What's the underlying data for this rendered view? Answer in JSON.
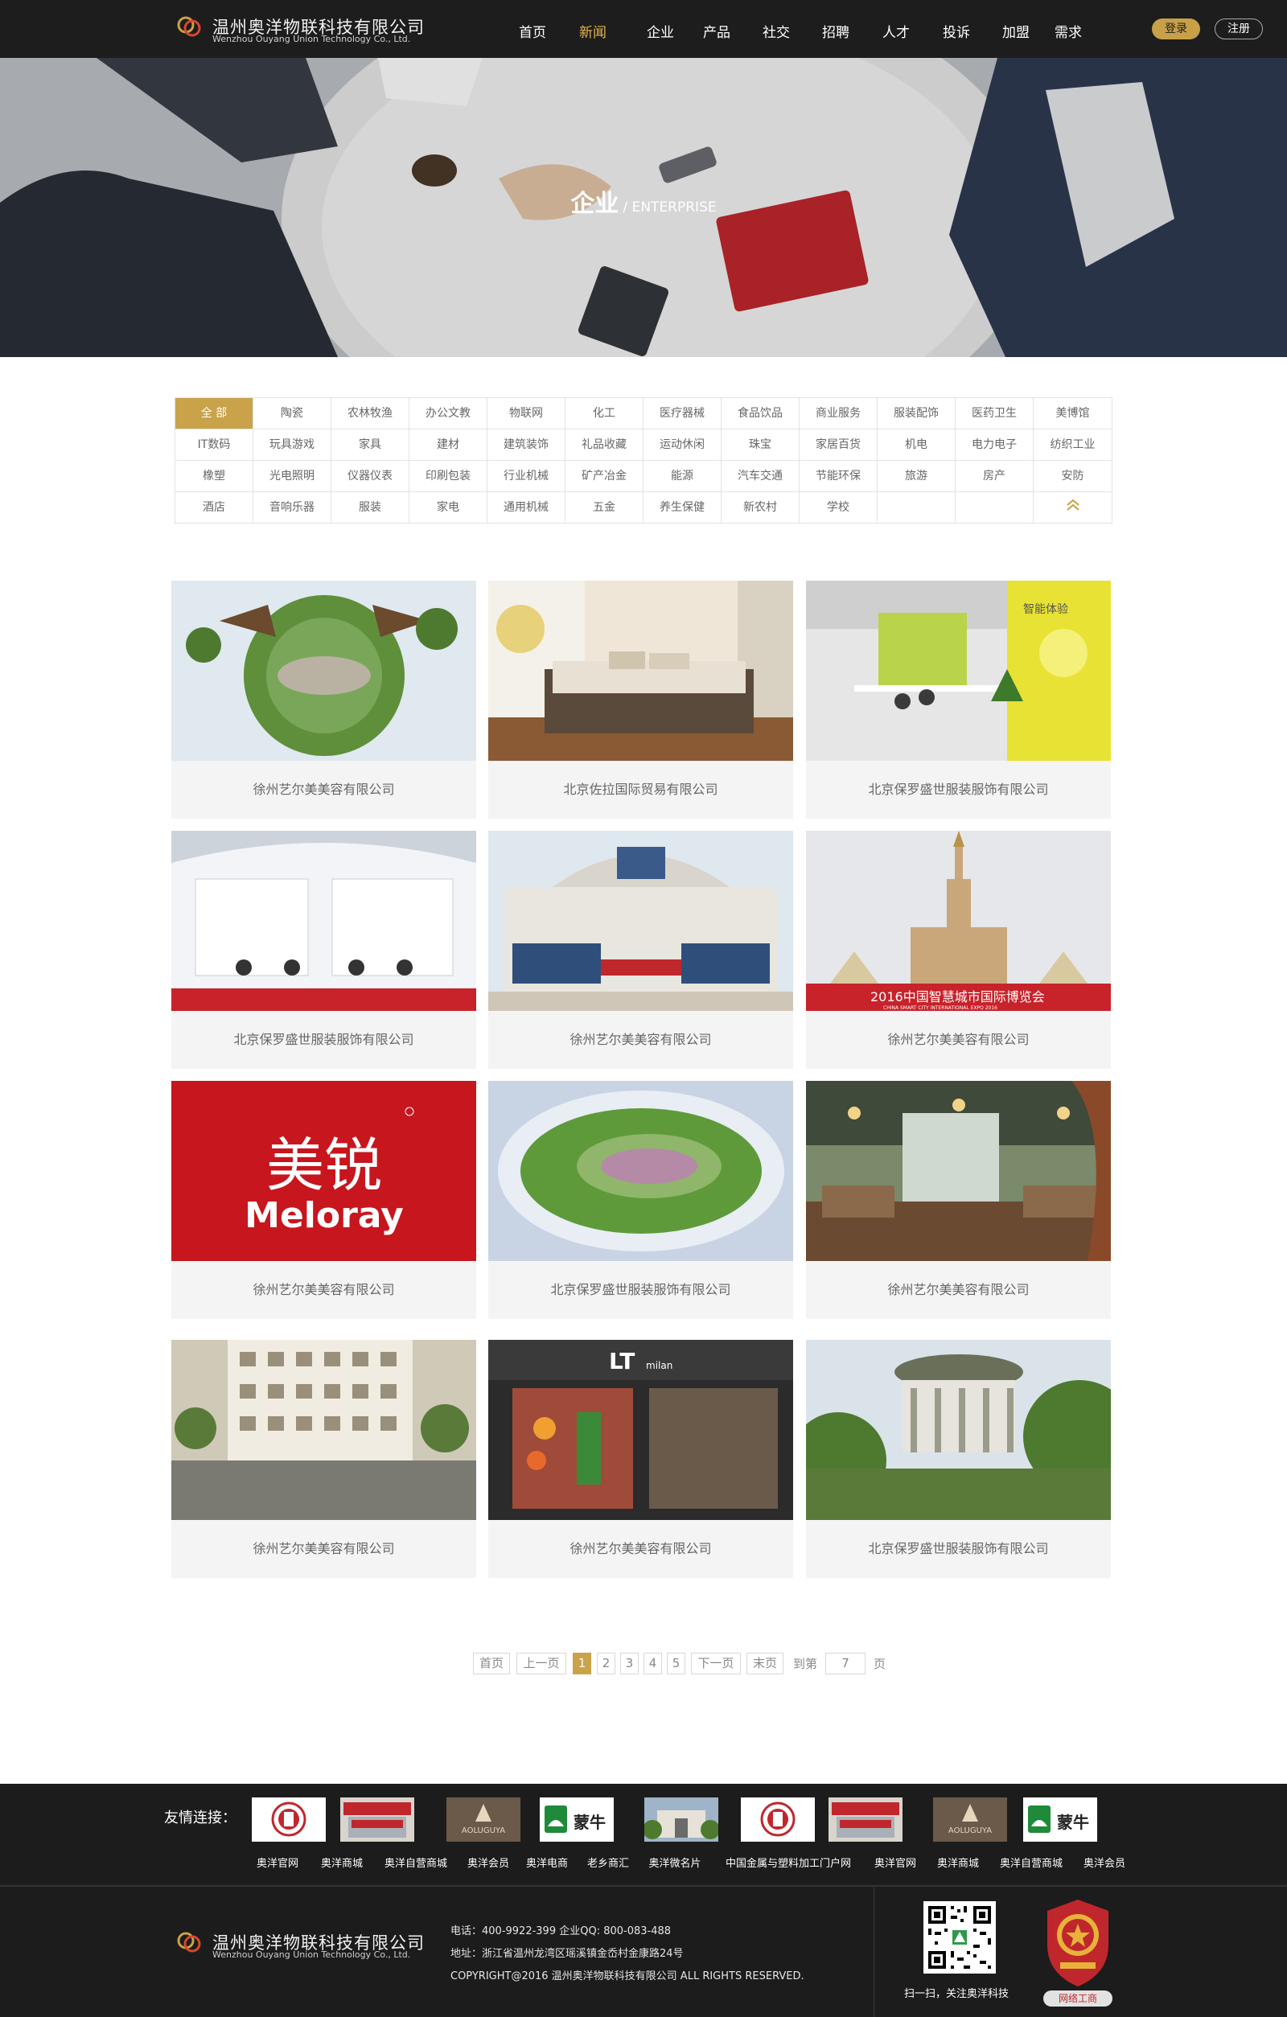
{
  "brand": {
    "name_cn": "温州奥洋物联科技有限公司",
    "name_en": "Wenzhou Ouyang Union Technology Co., Ltd.",
    "accent": "#c9a24a"
  },
  "nav": {
    "items": [
      "首页",
      "新闻",
      "企业",
      "产品",
      "社交",
      "招聘",
      "人才",
      "投诉",
      "加盟",
      "需求"
    ],
    "active": "新闻",
    "login": "登录",
    "register": "注册"
  },
  "banner": {
    "title_cn": "企业",
    "title_en": "/ ENTERPRISE"
  },
  "categories": [
    "全 部",
    "陶瓷",
    "农林牧渔",
    "办公文教",
    "物联网",
    "化工",
    "医疗器械",
    "食品饮品",
    "商业服务",
    "服装配饰",
    "医药卫生",
    "美博馆",
    "IT数码",
    "玩具游戏",
    "家具",
    "建材",
    "建筑装饰",
    "礼品收藏",
    "运动休闲",
    "珠宝",
    "家居百货",
    "机电",
    "电力电子",
    "纺织工业",
    "橡塑",
    "光电照明",
    "仪器仪表",
    "印刷包装",
    "行业机械",
    "矿产冶金",
    "能源",
    "汽车交通",
    "节能环保",
    "旅游",
    "房产",
    "安防",
    "酒店",
    "音响乐器",
    "服装",
    "家电",
    "通用机械",
    "五金",
    "养生保健",
    "新农村",
    "学校",
    "",
    "",
    ""
  ],
  "cards": [
    {
      "caption": "徐州艺尔美美容有限公司",
      "image": "planet-park"
    },
    {
      "caption": "北京佐拉国际贸易有限公司",
      "image": "bedroom"
    },
    {
      "caption": "北京保罗盛世服装服饰有限公司",
      "image": "expo-booth"
    },
    {
      "caption": "北京保罗盛世服装服饰有限公司",
      "image": "exhibition-hall"
    },
    {
      "caption": "徐州艺尔美美容有限公司",
      "image": "expo-building"
    },
    {
      "caption": "徐州艺尔美美容有限公司",
      "image": "exhibition-center"
    },
    {
      "caption": "徐州艺尔美美容有限公司",
      "image": "meloray-logo",
      "logo_cn": "美锐",
      "logo_en": "Meloray"
    },
    {
      "caption": "北京保罗盛世服装服饰有限公司",
      "image": "planet-fields"
    },
    {
      "caption": "徐州艺尔美美容有限公司",
      "image": "cafe"
    },
    {
      "caption": "徐州艺尔美美容有限公司",
      "image": "school-building"
    },
    {
      "caption": "徐州艺尔美美容有限公司",
      "image": "storefront",
      "store_sign": "LT",
      "store_sub": "milan"
    },
    {
      "caption": "北京保罗盛世服装服饰有限公司",
      "image": "pavilion"
    }
  ],
  "banner_texts": {
    "expo": "2016中国智慧城市国际博览会",
    "expo_en": "CHINA SMART CITY INTERNATIONAL EXPO 2016",
    "booth": "智能体验"
  },
  "pagination": {
    "first": "首页",
    "prev": "上一页",
    "pages": [
      "1",
      "2",
      "3",
      "4",
      "5"
    ],
    "current": "1",
    "next": "下一页",
    "last": "末页",
    "goto": "到第",
    "goto_value": "7",
    "page_unit": "页"
  },
  "friends": {
    "label": "友情连接：",
    "links": [
      "奥洋官网",
      "奥洋商城",
      "奥洋自营商城",
      "奥洋会员",
      "奥洋电商",
      "老乡商汇",
      "奥洋微名片",
      "中国金属与塑料加工门户网",
      "奥洋官网",
      "奥洋商城",
      "奥洋自营商城",
      "奥洋会员"
    ],
    "logos": [
      "seal",
      "banner-red",
      "aoluguya",
      "mengniu",
      "gate-building",
      "seal",
      "banner-red",
      "aoluguya",
      "mengniu"
    ],
    "logo_texts": {
      "aoluguya": "AOLUGUYA",
      "mengniu": "蒙牛"
    }
  },
  "footer": {
    "phone": "电话：400-9922-399   企业QQ: 800-083-488",
    "address": "地址：浙江省温州龙湾区瑶溪镇金岙村金康路24号",
    "copyright": "COPYRIGHT@2016 温州奥洋物联科技有限公司 ALL RIGHTS RESERVED.",
    "qr_caption": "扫一扫，关注奥洋科技",
    "badge_caption": "网络工商"
  }
}
